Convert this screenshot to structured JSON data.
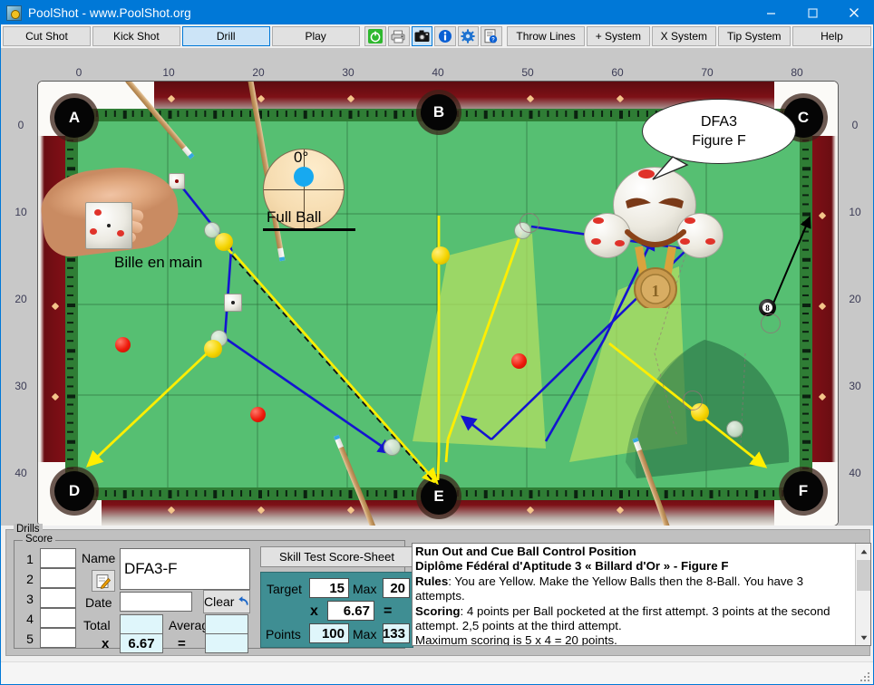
{
  "window": {
    "title": "PoolShot - www.PoolShot.org",
    "icon": "app-icon",
    "minimize": "minimize-icon",
    "maximize": "maximize-icon",
    "close": "close-icon"
  },
  "toolbar": {
    "mode_buttons": [
      {
        "label": "Cut Shot",
        "selected": false
      },
      {
        "label": "Kick Shot",
        "selected": false
      },
      {
        "label": "Drill",
        "selected": true
      },
      {
        "label": "Play",
        "selected": false
      }
    ],
    "icon_buttons": [
      {
        "name": "power-icon",
        "selected": false
      },
      {
        "name": "printer-icon",
        "selected": false
      },
      {
        "name": "camera-icon",
        "selected": true
      },
      {
        "name": "info-icon",
        "selected": false
      },
      {
        "name": "gear-icon",
        "selected": false
      },
      {
        "name": "document-help-icon",
        "selected": false
      }
    ],
    "system_buttons": [
      {
        "label": "Throw Lines"
      },
      {
        "label": "+ System"
      },
      {
        "label": "X System"
      },
      {
        "label": "Tip System"
      },
      {
        "label": "Help"
      }
    ]
  },
  "table": {
    "ruler_top": [
      "0",
      "10",
      "20",
      "30",
      "40",
      "50",
      "60",
      "70",
      "80"
    ],
    "ruler_left": [
      "0",
      "10",
      "20",
      "30",
      "40"
    ],
    "ruler_right": [
      "0",
      "10",
      "20",
      "30",
      "40"
    ],
    "pockets": [
      {
        "label": "A",
        "position": "top-left"
      },
      {
        "label": "B",
        "position": "top-middle"
      },
      {
        "label": "C",
        "position": "top-right"
      },
      {
        "label": "D",
        "position": "bottom-left"
      },
      {
        "label": "E",
        "position": "bottom-middle"
      },
      {
        "label": "F",
        "position": "bottom-right"
      }
    ],
    "annotations": {
      "ball_in_hand": "Bille en main",
      "angle": "0°",
      "hit_fullness": "Full Ball"
    },
    "speech_bubble": {
      "line1": "DFA3",
      "line2": "Figure F"
    },
    "medal_number": "1",
    "eight_ball_label": "8"
  },
  "drills": {
    "group_label": "Drills",
    "score_group_label": "Score",
    "score_rows": [
      "1",
      "2",
      "3",
      "4",
      "5"
    ],
    "score_values": [
      "",
      "",
      "",
      "",
      ""
    ],
    "name_label": "Name",
    "name_value": "DFA3-F",
    "name_edit_icon": "pencil-note-icon",
    "date_label": "Date",
    "date_value": "",
    "clear_label": "Clear",
    "clear_icon": "undo-arrow-icon",
    "total_label": "Total",
    "total_value": "",
    "average_label": "Average",
    "average_value": "",
    "multiply_label": "x",
    "multiplier_value": "6.67",
    "equals_label": "=",
    "result_value": "",
    "skill_test_label": "Skill Test Score-Sheet",
    "target_label": "Target",
    "target_value": "15",
    "target_max_label": "Max",
    "target_max_value": "20",
    "factor_x_label": "x",
    "factor_value": "6.67",
    "factor_equals": "=",
    "points_label": "Points",
    "points_value": "100",
    "points_max_label": "Max",
    "points_max_value": "133"
  },
  "description": {
    "title": "Run Out and Cue Ball Control Position",
    "subtitle": "Diplôme Fédéral d'Aptitude 3 « Billard d'Or » - Figure F",
    "rules_label": "Rules",
    "rules_text": ": You are Yellow. Make the Yellow Balls then the 8-Ball. You have 3 attempts.",
    "scoring_label": "Scoring",
    "scoring_text": ": 4 points per Ball pocketed at the first attempt. 3 points at the second attempt. 2,5 points at the third attempt.",
    "maximum_text": "Maximum scoring is 5 x 4 = 20 points.",
    "scroll_up_icon": "chevron-up-icon",
    "scroll_down_icon": "chevron-down-icon"
  },
  "colors": {
    "accent": "#0078d7",
    "cloth": "#56bf72",
    "cushion": "#2f7d35",
    "rail": "#7d1016",
    "teal_panel": "#3f8e93",
    "trajectory_object": "#ffee00",
    "trajectory_cue": "#1414d0",
    "ball_red": "#ef1b0c"
  }
}
